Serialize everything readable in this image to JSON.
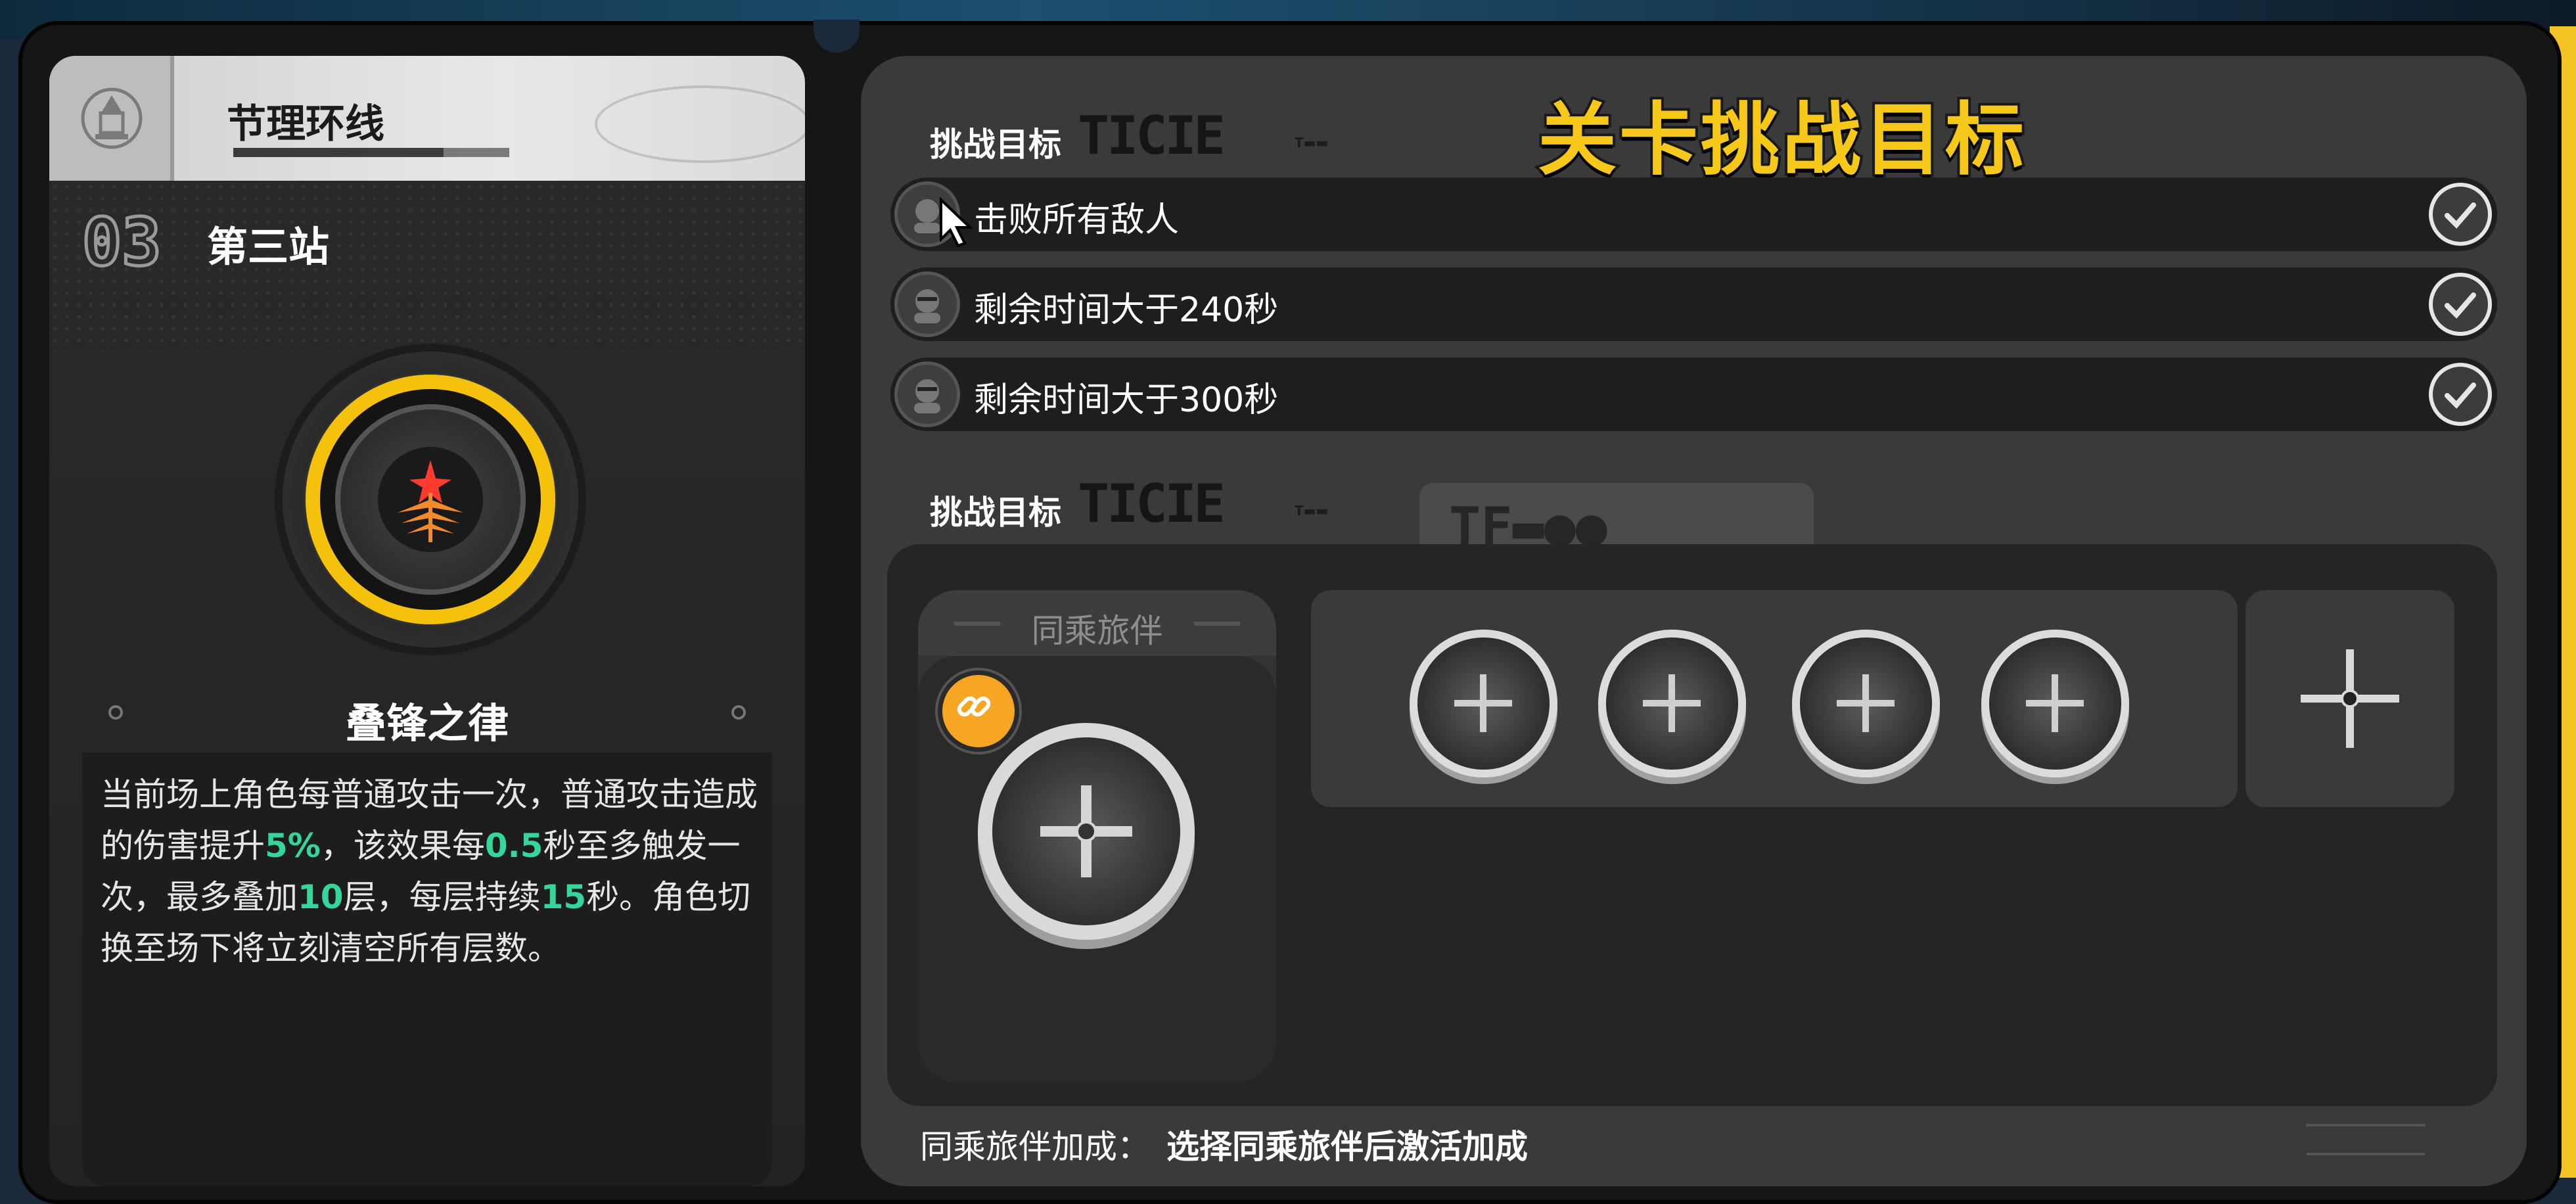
{
  "stage": {
    "route_name": "节理环线",
    "station_number": "03",
    "station_name": "第三站",
    "medal_icon": "flame-tree-emblem"
  },
  "buff": {
    "title": "叠锋之律",
    "desc_parts": [
      "当前场上角色每普通攻击一次，普通攻击造成的伤害提升",
      "5%",
      "，该效果每",
      "0.5",
      "秒至多触发一次，最多叠加",
      "10",
      "层，每层持续",
      "15",
      "秒。角色切换至场下将立刻清空所有层数。"
    ]
  },
  "header": {
    "title": "关卡挑战目标",
    "section_label_1": "挑战目标",
    "section_label_2": "挑战目标",
    "deco_word": "TICIE"
  },
  "objectives": [
    {
      "text": "击败所有敌人",
      "completed": true
    },
    {
      "text": "剩余时间大于240秒",
      "completed": true
    },
    {
      "text": "剩余时间大于300秒",
      "completed": true
    }
  ],
  "partner": {
    "card_title": "同乘旅伴",
    "bonus_label": "同乘旅伴加成：",
    "bonus_value": "选择同乘旅伴后激活加成",
    "link_icon": "chain-link-icon",
    "empty_slots": 4
  },
  "colors": {
    "accent_yellow": "#f6c81a",
    "highlight_green": "#35d69a",
    "link_orange": "#f6a623"
  }
}
